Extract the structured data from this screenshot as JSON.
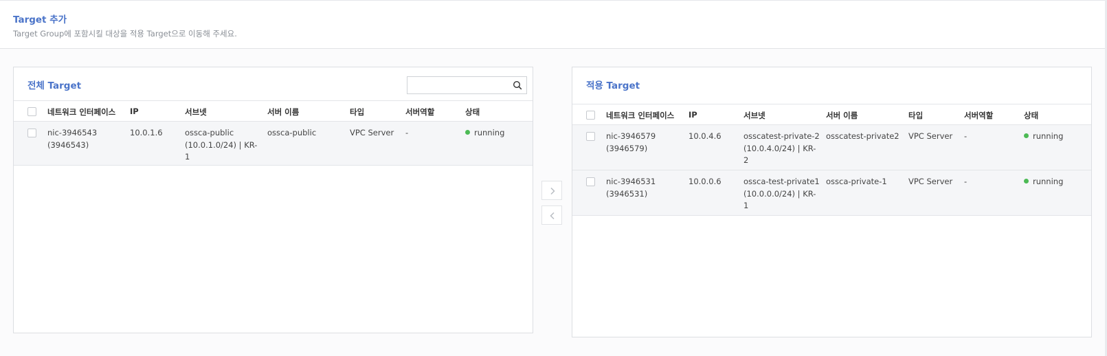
{
  "header": {
    "title": "Target 추가",
    "description": "Target Group에 포함시킬 대상을 적용 Target으로 이동해 주세요."
  },
  "left_panel": {
    "title": "전체 Target",
    "search": {
      "value": "",
      "placeholder": ""
    },
    "columns": [
      "네트워크 인터페이스",
      "IP",
      "서브넷",
      "서버 이름",
      "타입",
      "서버역할",
      "상태"
    ],
    "rows": [
      {
        "nic": "nic-3946543\n(3946543)",
        "ip": "10.0.1.6",
        "subnet": "ossca-public\n(10.0.1.0/24) | KR-\n1",
        "server_name": "ossca-public",
        "type": "VPC Server",
        "role": "-",
        "status": "running"
      }
    ]
  },
  "right_panel": {
    "title": "적용 Target",
    "columns": [
      "네트워크 인터페이스",
      "IP",
      "서브넷",
      "서버 이름",
      "타입",
      "서버역할",
      "상태"
    ],
    "rows": [
      {
        "nic": "nic-3946579\n(3946579)",
        "ip": "10.0.4.6",
        "subnet": "osscatest-private-2\n(10.0.4.0/24) | KR-\n2",
        "server_name": "osscatest-private2",
        "type": "VPC Server",
        "role": "-",
        "status": "running"
      },
      {
        "nic": "nic-3946531\n(3946531)",
        "ip": "10.0.0.6",
        "subnet": "ossca-test-private1\n(10.0.0.0/24) | KR-\n1",
        "server_name": "ossca-private-1",
        "type": "VPC Server",
        "role": "-",
        "status": "running"
      }
    ]
  },
  "move_buttons": {
    "right_icon": "chevron-right-icon",
    "left_icon": "chevron-left-icon"
  },
  "colors": {
    "accent": "#4b74c9",
    "status_running": "#4cba55"
  }
}
